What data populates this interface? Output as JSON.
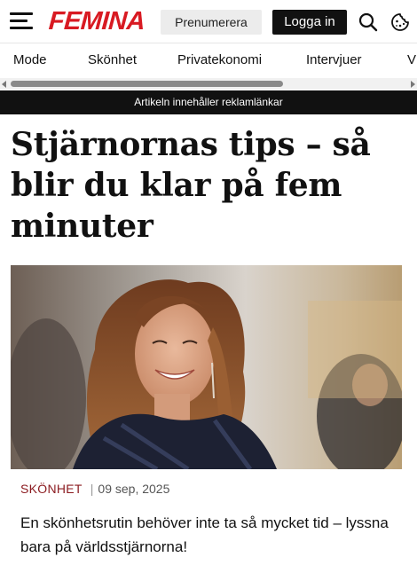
{
  "header": {
    "logo": "FEMINA",
    "subscribe_label": "Prenumerera",
    "login_label": "Logga in",
    "brand_color": "#d81a22",
    "icons": [
      "menu-icon",
      "search-icon",
      "cookie-icon"
    ]
  },
  "nav": {
    "items": [
      {
        "label": "Mode"
      },
      {
        "label": "Skönhet"
      },
      {
        "label": "Privatekonomi"
      },
      {
        "label": "Intervjuer"
      },
      {
        "label": "V"
      }
    ]
  },
  "ad_notice": "Artikeln innehåller reklamlänkar",
  "article": {
    "title": "Stjärnornas tips – så blir du klar på fem minuter",
    "category": "SKÖNHET",
    "date": "09 sep, 2025",
    "lead": "En skönhetsrutin behöver inte ta så mycket tid – lyssna bara på världsstjärnorna!",
    "category_color": "#8b1a1f"
  }
}
